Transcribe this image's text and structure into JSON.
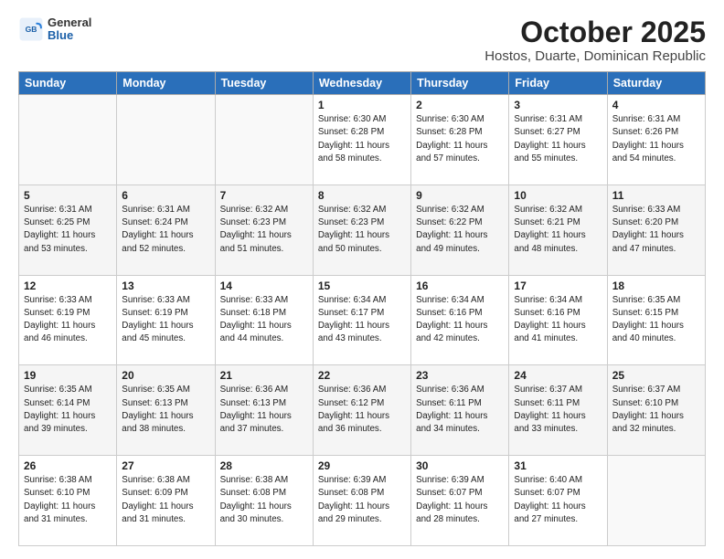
{
  "logo": {
    "general": "General",
    "blue": "Blue"
  },
  "title": "October 2025",
  "location": "Hostos, Duarte, Dominican Republic",
  "weekdays": [
    "Sunday",
    "Monday",
    "Tuesday",
    "Wednesday",
    "Thursday",
    "Friday",
    "Saturday"
  ],
  "weeks": [
    [
      {
        "day": "",
        "info": ""
      },
      {
        "day": "",
        "info": ""
      },
      {
        "day": "",
        "info": ""
      },
      {
        "day": "1",
        "info": "Sunrise: 6:30 AM\nSunset: 6:28 PM\nDaylight: 11 hours\nand 58 minutes."
      },
      {
        "day": "2",
        "info": "Sunrise: 6:30 AM\nSunset: 6:28 PM\nDaylight: 11 hours\nand 57 minutes."
      },
      {
        "day": "3",
        "info": "Sunrise: 6:31 AM\nSunset: 6:27 PM\nDaylight: 11 hours\nand 55 minutes."
      },
      {
        "day": "4",
        "info": "Sunrise: 6:31 AM\nSunset: 6:26 PM\nDaylight: 11 hours\nand 54 minutes."
      }
    ],
    [
      {
        "day": "5",
        "info": "Sunrise: 6:31 AM\nSunset: 6:25 PM\nDaylight: 11 hours\nand 53 minutes."
      },
      {
        "day": "6",
        "info": "Sunrise: 6:31 AM\nSunset: 6:24 PM\nDaylight: 11 hours\nand 52 minutes."
      },
      {
        "day": "7",
        "info": "Sunrise: 6:32 AM\nSunset: 6:23 PM\nDaylight: 11 hours\nand 51 minutes."
      },
      {
        "day": "8",
        "info": "Sunrise: 6:32 AM\nSunset: 6:23 PM\nDaylight: 11 hours\nand 50 minutes."
      },
      {
        "day": "9",
        "info": "Sunrise: 6:32 AM\nSunset: 6:22 PM\nDaylight: 11 hours\nand 49 minutes."
      },
      {
        "day": "10",
        "info": "Sunrise: 6:32 AM\nSunset: 6:21 PM\nDaylight: 11 hours\nand 48 minutes."
      },
      {
        "day": "11",
        "info": "Sunrise: 6:33 AM\nSunset: 6:20 PM\nDaylight: 11 hours\nand 47 minutes."
      }
    ],
    [
      {
        "day": "12",
        "info": "Sunrise: 6:33 AM\nSunset: 6:19 PM\nDaylight: 11 hours\nand 46 minutes."
      },
      {
        "day": "13",
        "info": "Sunrise: 6:33 AM\nSunset: 6:19 PM\nDaylight: 11 hours\nand 45 minutes."
      },
      {
        "day": "14",
        "info": "Sunrise: 6:33 AM\nSunset: 6:18 PM\nDaylight: 11 hours\nand 44 minutes."
      },
      {
        "day": "15",
        "info": "Sunrise: 6:34 AM\nSunset: 6:17 PM\nDaylight: 11 hours\nand 43 minutes."
      },
      {
        "day": "16",
        "info": "Sunrise: 6:34 AM\nSunset: 6:16 PM\nDaylight: 11 hours\nand 42 minutes."
      },
      {
        "day": "17",
        "info": "Sunrise: 6:34 AM\nSunset: 6:16 PM\nDaylight: 11 hours\nand 41 minutes."
      },
      {
        "day": "18",
        "info": "Sunrise: 6:35 AM\nSunset: 6:15 PM\nDaylight: 11 hours\nand 40 minutes."
      }
    ],
    [
      {
        "day": "19",
        "info": "Sunrise: 6:35 AM\nSunset: 6:14 PM\nDaylight: 11 hours\nand 39 minutes."
      },
      {
        "day": "20",
        "info": "Sunrise: 6:35 AM\nSunset: 6:13 PM\nDaylight: 11 hours\nand 38 minutes."
      },
      {
        "day": "21",
        "info": "Sunrise: 6:36 AM\nSunset: 6:13 PM\nDaylight: 11 hours\nand 37 minutes."
      },
      {
        "day": "22",
        "info": "Sunrise: 6:36 AM\nSunset: 6:12 PM\nDaylight: 11 hours\nand 36 minutes."
      },
      {
        "day": "23",
        "info": "Sunrise: 6:36 AM\nSunset: 6:11 PM\nDaylight: 11 hours\nand 34 minutes."
      },
      {
        "day": "24",
        "info": "Sunrise: 6:37 AM\nSunset: 6:11 PM\nDaylight: 11 hours\nand 33 minutes."
      },
      {
        "day": "25",
        "info": "Sunrise: 6:37 AM\nSunset: 6:10 PM\nDaylight: 11 hours\nand 32 minutes."
      }
    ],
    [
      {
        "day": "26",
        "info": "Sunrise: 6:38 AM\nSunset: 6:10 PM\nDaylight: 11 hours\nand 31 minutes."
      },
      {
        "day": "27",
        "info": "Sunrise: 6:38 AM\nSunset: 6:09 PM\nDaylight: 11 hours\nand 31 minutes."
      },
      {
        "day": "28",
        "info": "Sunrise: 6:38 AM\nSunset: 6:08 PM\nDaylight: 11 hours\nand 30 minutes."
      },
      {
        "day": "29",
        "info": "Sunrise: 6:39 AM\nSunset: 6:08 PM\nDaylight: 11 hours\nand 29 minutes."
      },
      {
        "day": "30",
        "info": "Sunrise: 6:39 AM\nSunset: 6:07 PM\nDaylight: 11 hours\nand 28 minutes."
      },
      {
        "day": "31",
        "info": "Sunrise: 6:40 AM\nSunset: 6:07 PM\nDaylight: 11 hours\nand 27 minutes."
      },
      {
        "day": "",
        "info": ""
      }
    ]
  ]
}
